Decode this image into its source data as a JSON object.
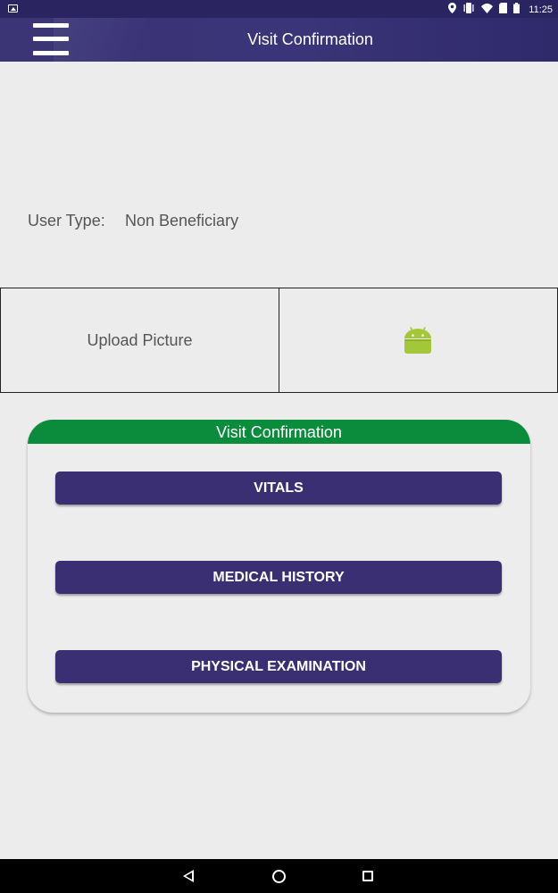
{
  "status_bar": {
    "time": "11:25",
    "icons": [
      "image-notification-icon",
      "location-icon",
      "vibrate-icon",
      "wifi-icon",
      "sim-icon",
      "battery-icon"
    ]
  },
  "app_bar": {
    "title": "Visit Confirmation",
    "menu_icon": "hamburger-menu-icon"
  },
  "user_type": {
    "label": "User Type:",
    "value": "Non Beneficiary"
  },
  "upload": {
    "label": "Upload Picture",
    "preview_icon": "android-icon"
  },
  "card": {
    "title": "Visit Confirmation",
    "buttons": [
      {
        "label": "VITALS"
      },
      {
        "label": "MEDICAL HISTORY"
      },
      {
        "label": "PHYSICAL EXAMINATION"
      }
    ]
  },
  "nav_bar": {
    "icons": [
      "back-icon",
      "home-icon",
      "recent-apps-icon"
    ]
  },
  "colors": {
    "primary": "#3b2f74",
    "app_bar": "#3a3478",
    "card_header": "#0a8c3c",
    "android_green": "#a4c639",
    "background": "#ececec"
  }
}
